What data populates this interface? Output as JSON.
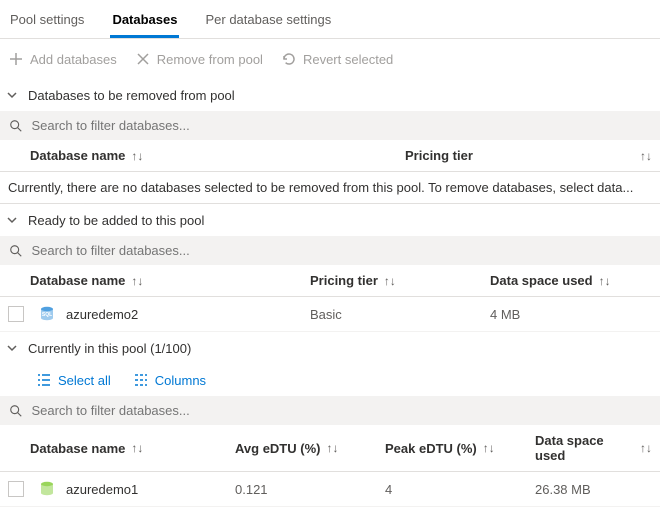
{
  "tabs": {
    "pool_settings": "Pool settings",
    "databases": "Databases",
    "per_database": "Per database settings"
  },
  "toolbar": {
    "add": "Add databases",
    "remove": "Remove from pool",
    "revert": "Revert selected"
  },
  "search_placeholder": "Search to filter databases...",
  "columns": {
    "db_name": "Database name",
    "pricing_tier": "Pricing tier",
    "data_space": "Data space used",
    "avg_edtu": "Avg eDTU (%)",
    "peak_edtu": "Peak eDTU (%)"
  },
  "section_removed": {
    "title": "Databases to be removed from pool",
    "empty_msg": "Currently, there are no databases selected to be removed from this pool. To remove databases, select data..."
  },
  "section_ready": {
    "title": "Ready to be added to this pool",
    "rows": [
      {
        "name": "azuredemo2",
        "tier": "Basic",
        "space": "4 MB"
      }
    ]
  },
  "section_current": {
    "title": "Currently in this pool (1/100)",
    "actions": {
      "select_all": "Select all",
      "columns": "Columns"
    },
    "rows": [
      {
        "name": "azuredemo1",
        "avg": "0.121",
        "peak": "4",
        "space": "26.38 MB"
      }
    ]
  }
}
